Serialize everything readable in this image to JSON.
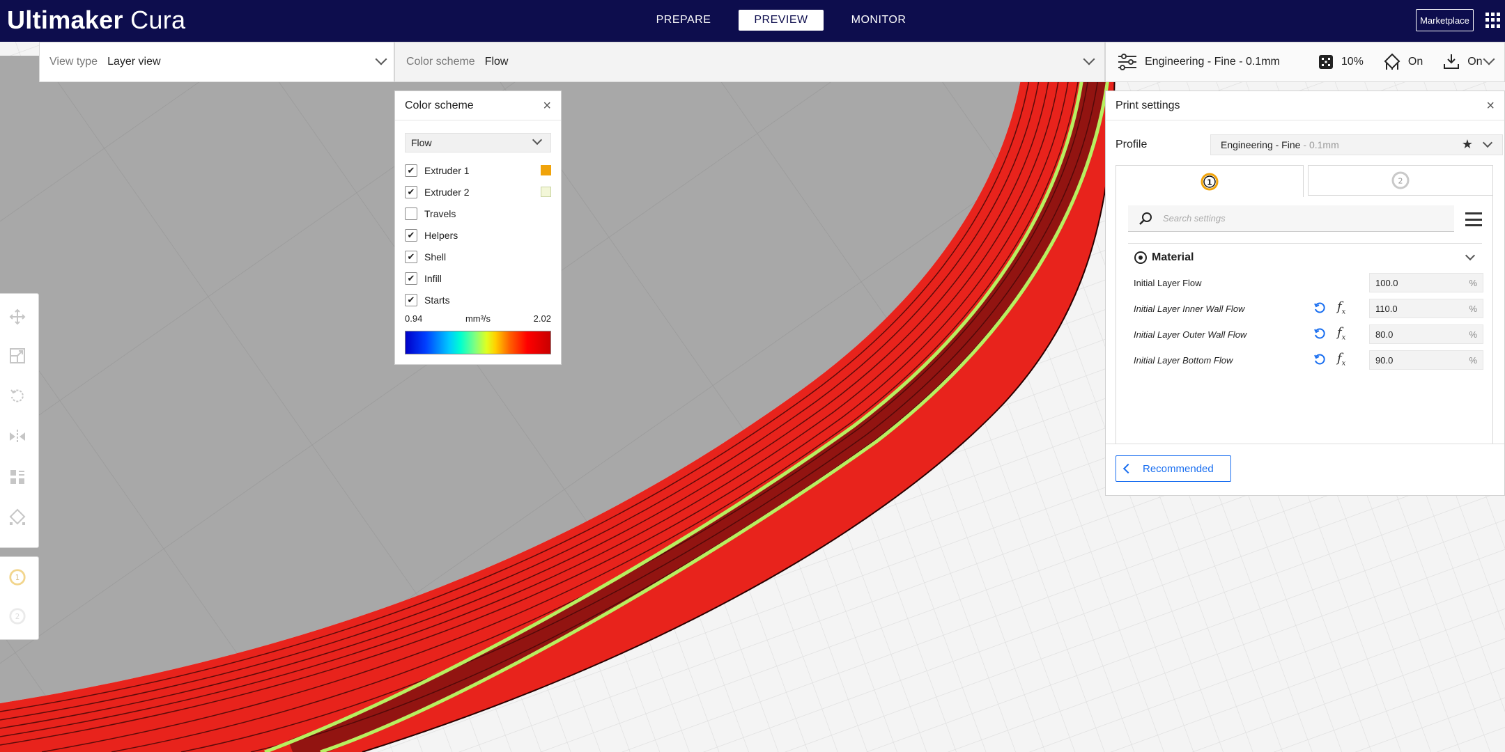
{
  "app": {
    "brand_bold": "Ultimaker",
    "brand_light": "Cura",
    "stages": [
      "PREPARE",
      "PREVIEW",
      "MONITOR"
    ],
    "active_stage": "PREVIEW",
    "marketplace_label": "Marketplace"
  },
  "view_bar": {
    "view_type_label": "View type",
    "view_type_value": "Layer view",
    "color_scheme_label": "Color scheme",
    "color_scheme_value": "Flow"
  },
  "print_bar": {
    "profile": "Engineering - Fine - 0.1mm",
    "infill": "10%",
    "support": "On",
    "adhesion": "On"
  },
  "color_scheme_panel": {
    "title": "Color scheme",
    "selected": "Flow",
    "items": [
      {
        "label": "Extruder 1",
        "checked": true,
        "swatch": "#f0a30a"
      },
      {
        "label": "Extruder 2",
        "checked": true,
        "swatch": "#f3f7d8"
      },
      {
        "label": "Travels",
        "checked": false
      },
      {
        "label": "Helpers",
        "checked": true
      },
      {
        "label": "Shell",
        "checked": true
      },
      {
        "label": "Infill",
        "checked": true
      },
      {
        "label": "Starts",
        "checked": true
      }
    ],
    "range_min": "0.94",
    "range_unit": "mm³/s",
    "range_max": "2.02"
  },
  "print_settings_panel": {
    "title": "Print settings",
    "profile_label": "Profile",
    "profile_name": "Engineering - Fine",
    "profile_suffix": "- 0.1mm",
    "extruder_tabs": [
      "1",
      "2"
    ],
    "search_placeholder": "Search settings",
    "category": "Material",
    "settings": [
      {
        "name": "Initial Layer Flow",
        "value": "100.0",
        "unit": "%",
        "modified": false
      },
      {
        "name": "Initial Layer Inner Wall Flow",
        "value": "110.0",
        "unit": "%",
        "modified": true
      },
      {
        "name": "Initial Layer Outer Wall Flow",
        "value": "80.0",
        "unit": "%",
        "modified": true
      },
      {
        "name": "Initial Layer Bottom Flow",
        "value": "90.0",
        "unit": "%",
        "modified": true
      }
    ],
    "recommended_label": "Recommended"
  },
  "colors": {
    "topbar": "#0d0d4d",
    "accent": "#196ef0",
    "flow_red": "#e8231c",
    "flow_green": "#b8f060"
  }
}
